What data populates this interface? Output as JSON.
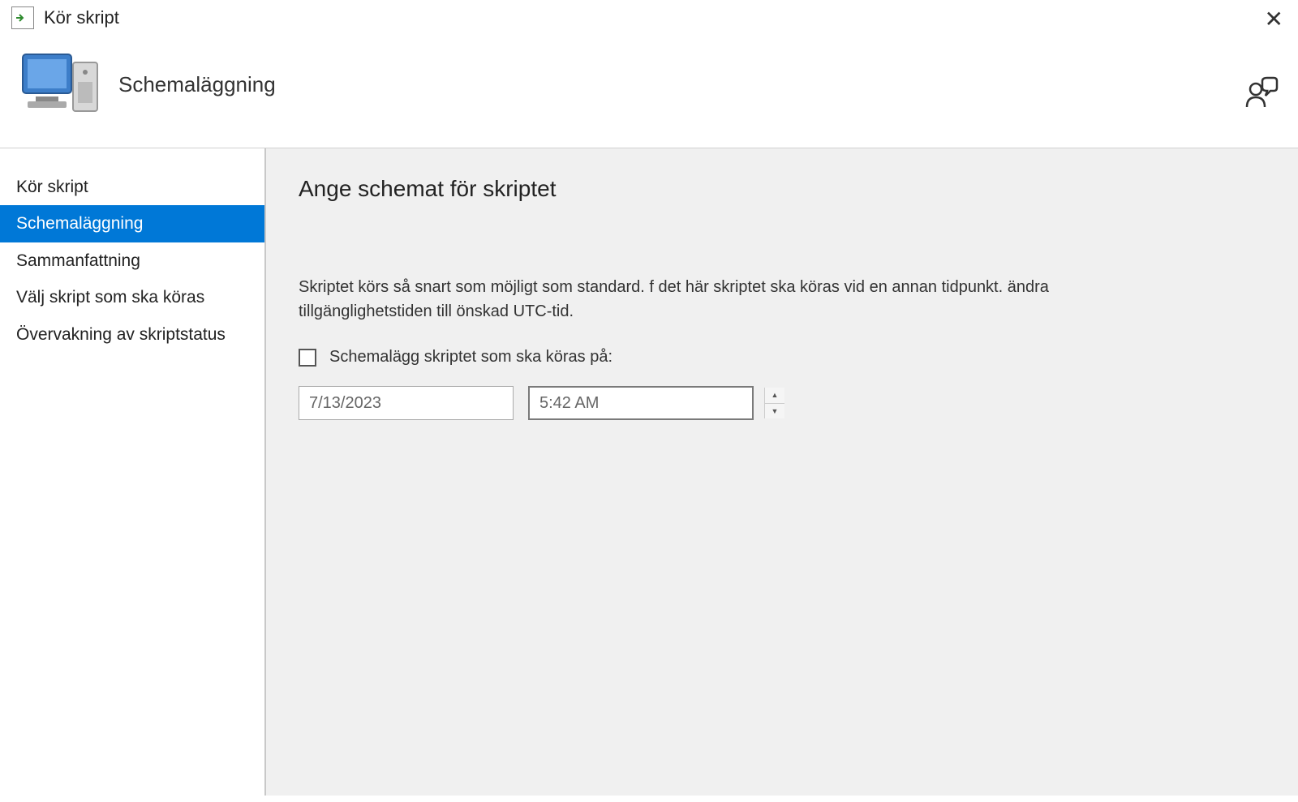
{
  "window": {
    "title": "Kör skript"
  },
  "header": {
    "page_title": "Schemaläggning"
  },
  "sidebar": {
    "items": [
      {
        "label": "Kör skript",
        "selected": false
      },
      {
        "label": "Schemaläggning",
        "selected": true
      },
      {
        "label": "Sammanfattning",
        "selected": false
      },
      {
        "label": "Välj skript som ska köras",
        "selected": false
      },
      {
        "label": "Övervakning av skriptstatus",
        "selected": false
      }
    ]
  },
  "content": {
    "heading": "Ange schemat för skriptet",
    "description": "Skriptet körs så snart som möjligt som standard. f det här skriptet ska köras vid en annan tidpunkt. ändra tillgänglighetstiden till önskad UTC-tid.",
    "schedule_checkbox_label": "Schemalägg skriptet som ska köras på:",
    "schedule_checked": false,
    "date_value": "7/13/2023",
    "time_value": "5:42 AM"
  }
}
